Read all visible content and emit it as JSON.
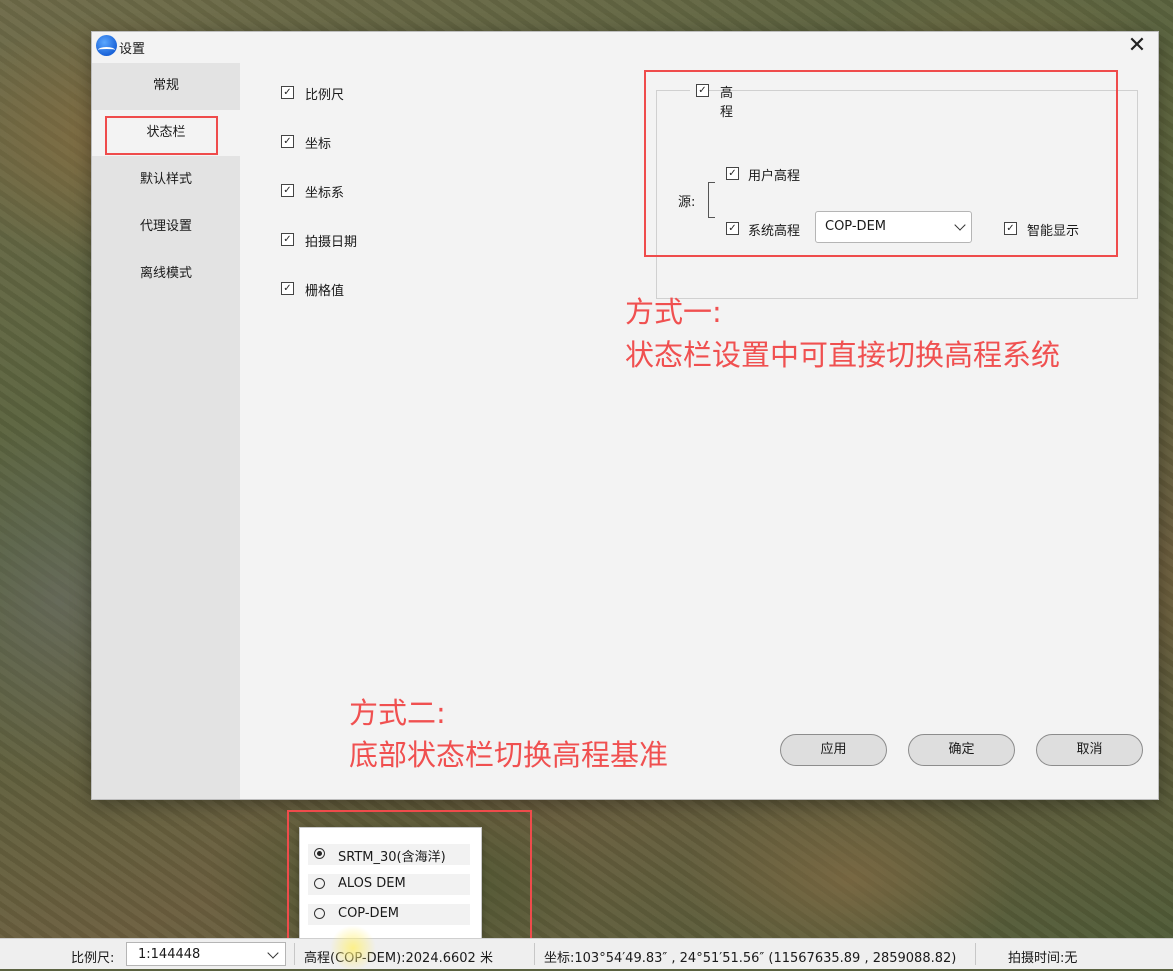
{
  "dialog": {
    "title": "设置",
    "close_glyph": "✕",
    "nav": [
      {
        "label": "常规"
      },
      {
        "label": "状态栏"
      },
      {
        "label": "默认样式"
      },
      {
        "label": "代理设置"
      },
      {
        "label": "离线模式"
      }
    ],
    "active_nav": "状态栏",
    "options": [
      {
        "label": "比例尺",
        "checked": true
      },
      {
        "label": "坐标",
        "checked": true
      },
      {
        "label": "坐标系",
        "checked": true
      },
      {
        "label": "拍摄日期",
        "checked": true
      },
      {
        "label": "栅格值",
        "checked": true
      }
    ],
    "elevation": {
      "group_label": "高程",
      "source_label": "源:",
      "user_elevation": "用户高程",
      "system_elevation": "系统高程",
      "system_source": "COP-DEM",
      "smart_display": "智能显示"
    },
    "buttons": {
      "apply": "应用",
      "ok": "确定",
      "cancel": "取消"
    },
    "check_glyph": "✓"
  },
  "annotations": {
    "method1_title": "方式一:",
    "method1_text": "状态栏设置中可直接切换高程系统",
    "method2_title": "方式二:",
    "method2_text": "底部状态栏切换高程基准"
  },
  "popup": {
    "options": [
      {
        "label": "SRTM_30(含海洋)",
        "selected": true
      },
      {
        "label": "ALOS DEM",
        "selected": false
      },
      {
        "label": "COP-DEM",
        "selected": false
      }
    ]
  },
  "statusbar": {
    "scale_label": "比例尺:",
    "scale_value": "1:144448",
    "elevation": "高程(COP-DEM):2024.6602 米",
    "coordinates": "坐标:103°54′49.83″ , 24°51′51.56″ (11567635.89 , 2859088.82)",
    "capture_time": "拍摄时间:无"
  },
  "colors": {
    "annotation_red": "#ef4b4b",
    "brand_blue": "#1a63d8"
  }
}
